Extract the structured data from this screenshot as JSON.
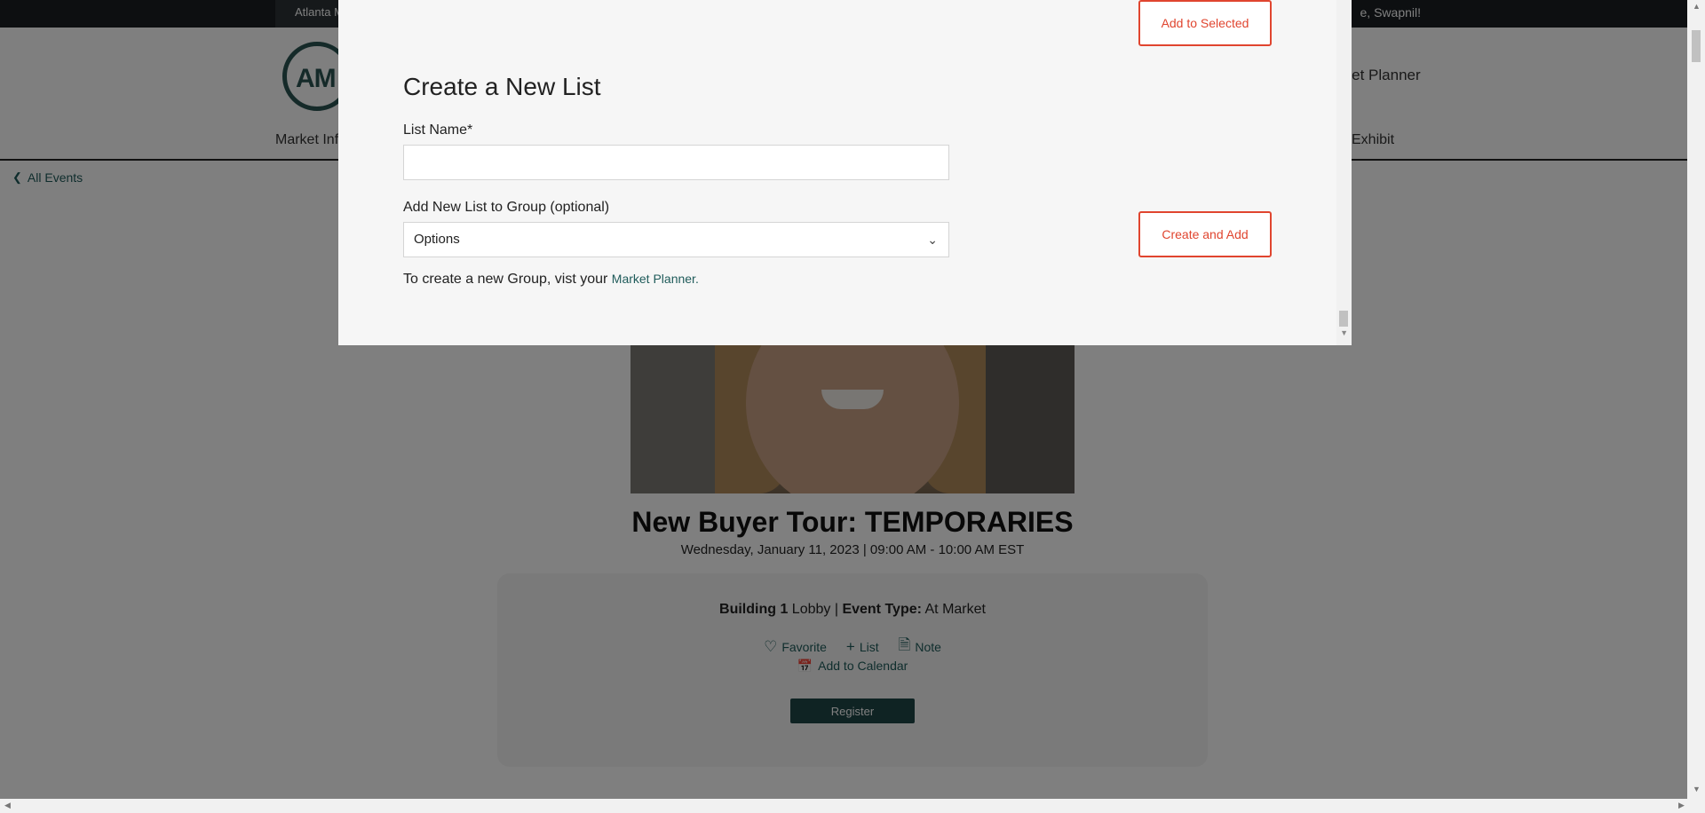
{
  "topbar": {
    "left_tab": "Atlanta M",
    "welcome": "e, Swapnil!"
  },
  "header": {
    "logo_text": "AM",
    "market_planner": "rket Planner",
    "nav_left": "Market Inf",
    "nav_right": "Exhibit"
  },
  "back_link": "All Events",
  "event": {
    "title": "New Buyer Tour: TEMPORARIES",
    "date": "Wednesday, January 11, 2023 | 09:00 AM - 10:00 AM EST",
    "building_label": "Building 1",
    "building_location": " Lobby | ",
    "event_type_label": "Event Type:",
    "event_type_value": " At Market",
    "favorite_label": "Favorite",
    "list_label": "List",
    "note_label": "Note",
    "calendar_label": "Add to Calendar",
    "register_label": "Register"
  },
  "modal": {
    "add_to_selected_label": "Add to Selected",
    "heading": "Create a New List",
    "list_name_label": "List Name*",
    "list_name_value": "",
    "group_label": "Add New List to Group (optional)",
    "group_selected": "Options",
    "create_and_add_label": "Create and Add",
    "note_prefix": "To create a new Group, vist your ",
    "note_link": "Market Planner."
  },
  "icons": {
    "back": "chevron-left-icon",
    "favorite": "heart-icon",
    "list": "plus-icon",
    "note": "document-icon",
    "calendar": "calendar-icon",
    "select": "chevron-down-icon"
  },
  "colors": {
    "accent_teal": "#1f5b5a",
    "button_red": "#e0452f",
    "register_bg": "#1f4647",
    "topbar_bg": "#1a1f23"
  }
}
